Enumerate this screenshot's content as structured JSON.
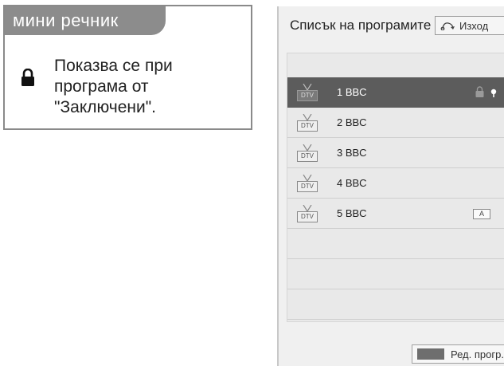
{
  "glossary": {
    "title": "мини речник",
    "icon": "lock-icon",
    "description": "Показва се при\nпрограма от\n\"Заключени\"."
  },
  "panel": {
    "title": "Списък на програмите",
    "exit_label": "Изход",
    "exit_icon": "return-arrow-icon",
    "channels": [
      {
        "type": "DTV",
        "name": "1 BBC",
        "selected": true,
        "locked": true
      },
      {
        "type": "DTV",
        "name": "2 BBC"
      },
      {
        "type": "DTV",
        "name": "3 BBC"
      },
      {
        "type": "DTV",
        "name": "4 BBC"
      },
      {
        "type": "DTV",
        "name": "5 BBC",
        "badge": "A"
      }
    ],
    "footer_label": "Ред. прогр.",
    "footer_swatch_color": "#6e6e6e"
  },
  "colors": {
    "glossary_tab": "#8c8c8c",
    "selected_row": "#5c5c5c",
    "panel_bg": "#f0f0f0"
  }
}
